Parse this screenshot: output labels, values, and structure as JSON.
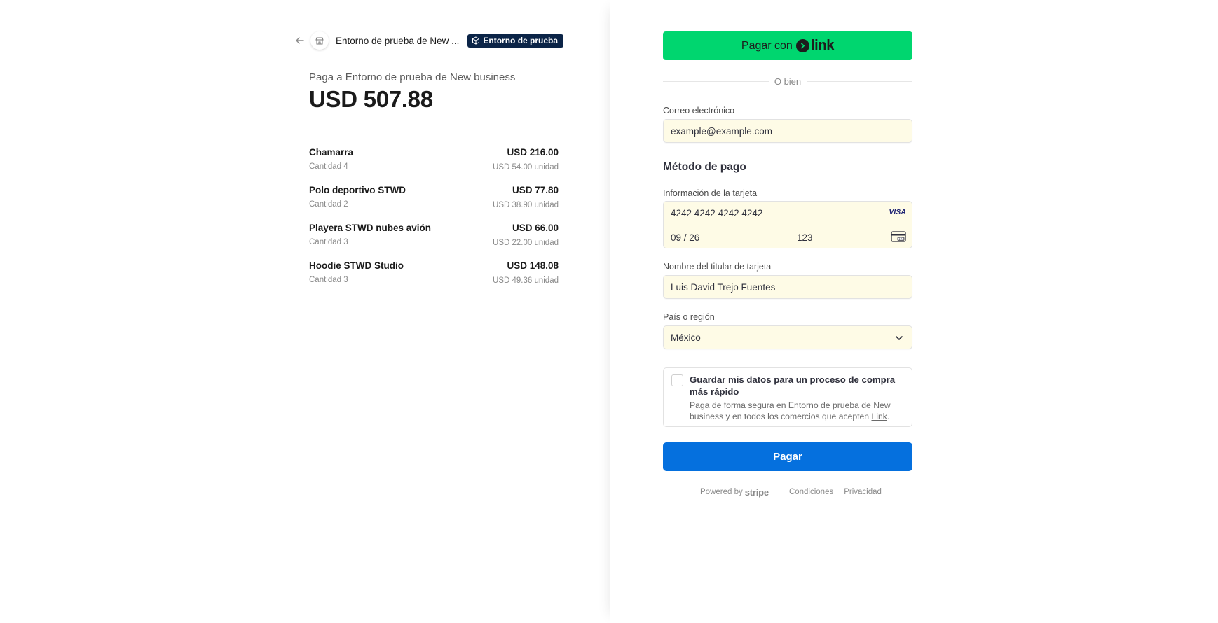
{
  "header": {
    "merchant_name": "Entorno de prueba de New ...",
    "test_badge": "Entorno de prueba"
  },
  "summary": {
    "pay_to": "Paga a Entorno de prueba de New business",
    "total": "USD 507.88"
  },
  "items": [
    {
      "name": "Chamarra",
      "qty": "Cantidad 4",
      "price": "USD 216.00",
      "unit": "USD 54.00 unidad"
    },
    {
      "name": "Polo deportivo STWD",
      "qty": "Cantidad 2",
      "price": "USD 77.80",
      "unit": "USD 38.90 unidad"
    },
    {
      "name": "Playera STWD nubes avión",
      "qty": "Cantidad 3",
      "price": "USD 66.00",
      "unit": "USD 22.00 unidad"
    },
    {
      "name": "Hoodie STWD Studio",
      "qty": "Cantidad 3",
      "price": "USD 148.08",
      "unit": "USD 49.36 unidad"
    }
  ],
  "link_button": {
    "prefix": "Pagar con",
    "brand": "link"
  },
  "divider_text": "O bien",
  "email": {
    "label": "Correo electrónico",
    "value": "example@example.com"
  },
  "payment_method": {
    "title": "Método de pago",
    "card_label": "Información de la tarjeta",
    "card_number": "4242 4242 4242 4242",
    "card_brand": "VISA",
    "expiry": "09 / 26",
    "cvc": "123"
  },
  "cardholder": {
    "label": "Nombre del titular de tarjeta",
    "value": "Luis David Trejo Fuentes"
  },
  "country": {
    "label": "País o región",
    "value": "México"
  },
  "save_info": {
    "title": "Guardar mis datos para un proceso de compra más rápido",
    "desc_before": "Paga de forma segura en Entorno de prueba de New business y en todos los comercios que acepten ",
    "desc_link": "Link",
    "desc_after": "."
  },
  "pay_button": "Pagar",
  "footer": {
    "powered_by": "Powered by",
    "stripe": "stripe",
    "terms": "Condiciones",
    "privacy": "Privacidad"
  },
  "colors": {
    "link_green": "#00d66f",
    "pay_blue": "#0570de",
    "badge_navy": "#0b2447",
    "autofill_yellow": "#fefbe6"
  },
  "icons": [
    "arrow-left-icon",
    "store-icon",
    "cube-icon",
    "link-arrow-icon",
    "visa-icon",
    "cvc-card-icon",
    "chevron-down-icon"
  ]
}
